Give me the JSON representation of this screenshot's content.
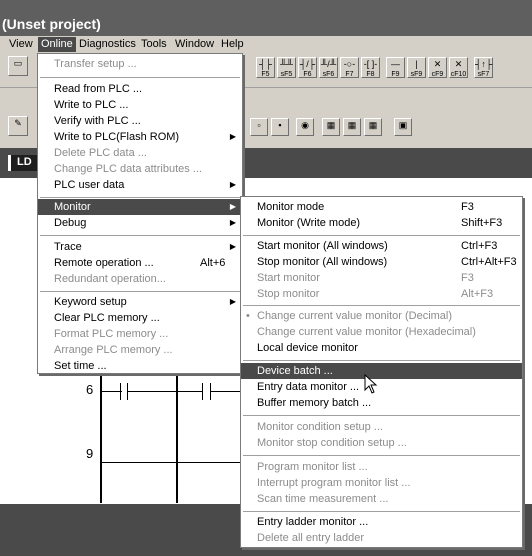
{
  "window": {
    "title": "(Unset project)"
  },
  "menubar": [
    {
      "label": "View"
    },
    {
      "label": "Online"
    },
    {
      "label": "Diagnostics"
    },
    {
      "label": "Tools"
    },
    {
      "label": "Window"
    },
    {
      "label": "Help"
    }
  ],
  "toolbar_keys": [
    "F5",
    "sF5",
    "F6",
    "sF6",
    "F7",
    "F8",
    "F9",
    "sF9",
    "cF9",
    "cF10",
    "sF7"
  ],
  "editor": {
    "tab": "LD",
    "rung_numbers": [
      "6",
      "9"
    ]
  },
  "online_menu": {
    "items": [
      {
        "label": "Transfer setup ..."
      },
      {
        "label": "Read from PLC ..."
      },
      {
        "label": "Write to PLC ..."
      },
      {
        "label": "Verify with PLC ..."
      },
      {
        "label": "Write to PLC(Flash ROM)"
      },
      {
        "label": "Delete PLC data ..."
      },
      {
        "label": "Change PLC data attributes ..."
      },
      {
        "label": "PLC user data"
      },
      {
        "label": "Monitor"
      },
      {
        "label": "Debug"
      },
      {
        "label": "Trace"
      },
      {
        "label": "Remote operation ...",
        "shortcut": "Alt+6"
      },
      {
        "label": "Redundant operation..."
      },
      {
        "label": "Keyword setup"
      },
      {
        "label": "Clear PLC memory ..."
      },
      {
        "label": "Format PLC memory ..."
      },
      {
        "label": "Arrange PLC memory ..."
      },
      {
        "label": "Set time ..."
      }
    ]
  },
  "monitor_submenu": {
    "items": [
      {
        "label": "Monitor mode",
        "shortcut": "F3"
      },
      {
        "label": "Monitor (Write mode)",
        "shortcut": "Shift+F3"
      },
      {
        "label": "Start monitor (All windows)",
        "shortcut": "Ctrl+F3"
      },
      {
        "label": "Stop monitor (All windows)",
        "shortcut": "Ctrl+Alt+F3"
      },
      {
        "label": "Start monitor",
        "shortcut": "F3"
      },
      {
        "label": "Stop monitor",
        "shortcut": "Alt+F3"
      },
      {
        "label": "Change current value monitor (Decimal)"
      },
      {
        "label": "Change current value monitor (Hexadecimal)"
      },
      {
        "label": "Local device monitor"
      },
      {
        "label": "Device batch ..."
      },
      {
        "label": "Entry data monitor ..."
      },
      {
        "label": "Buffer memory batch ..."
      },
      {
        "label": "Monitor condition setup ..."
      },
      {
        "label": "Monitor stop condition setup ..."
      },
      {
        "label": "Program monitor list ..."
      },
      {
        "label": "Interrupt program monitor list ..."
      },
      {
        "label": "Scan time measurement ..."
      },
      {
        "label": "Entry ladder monitor ..."
      },
      {
        "label": "Delete all entry ladder"
      }
    ]
  }
}
